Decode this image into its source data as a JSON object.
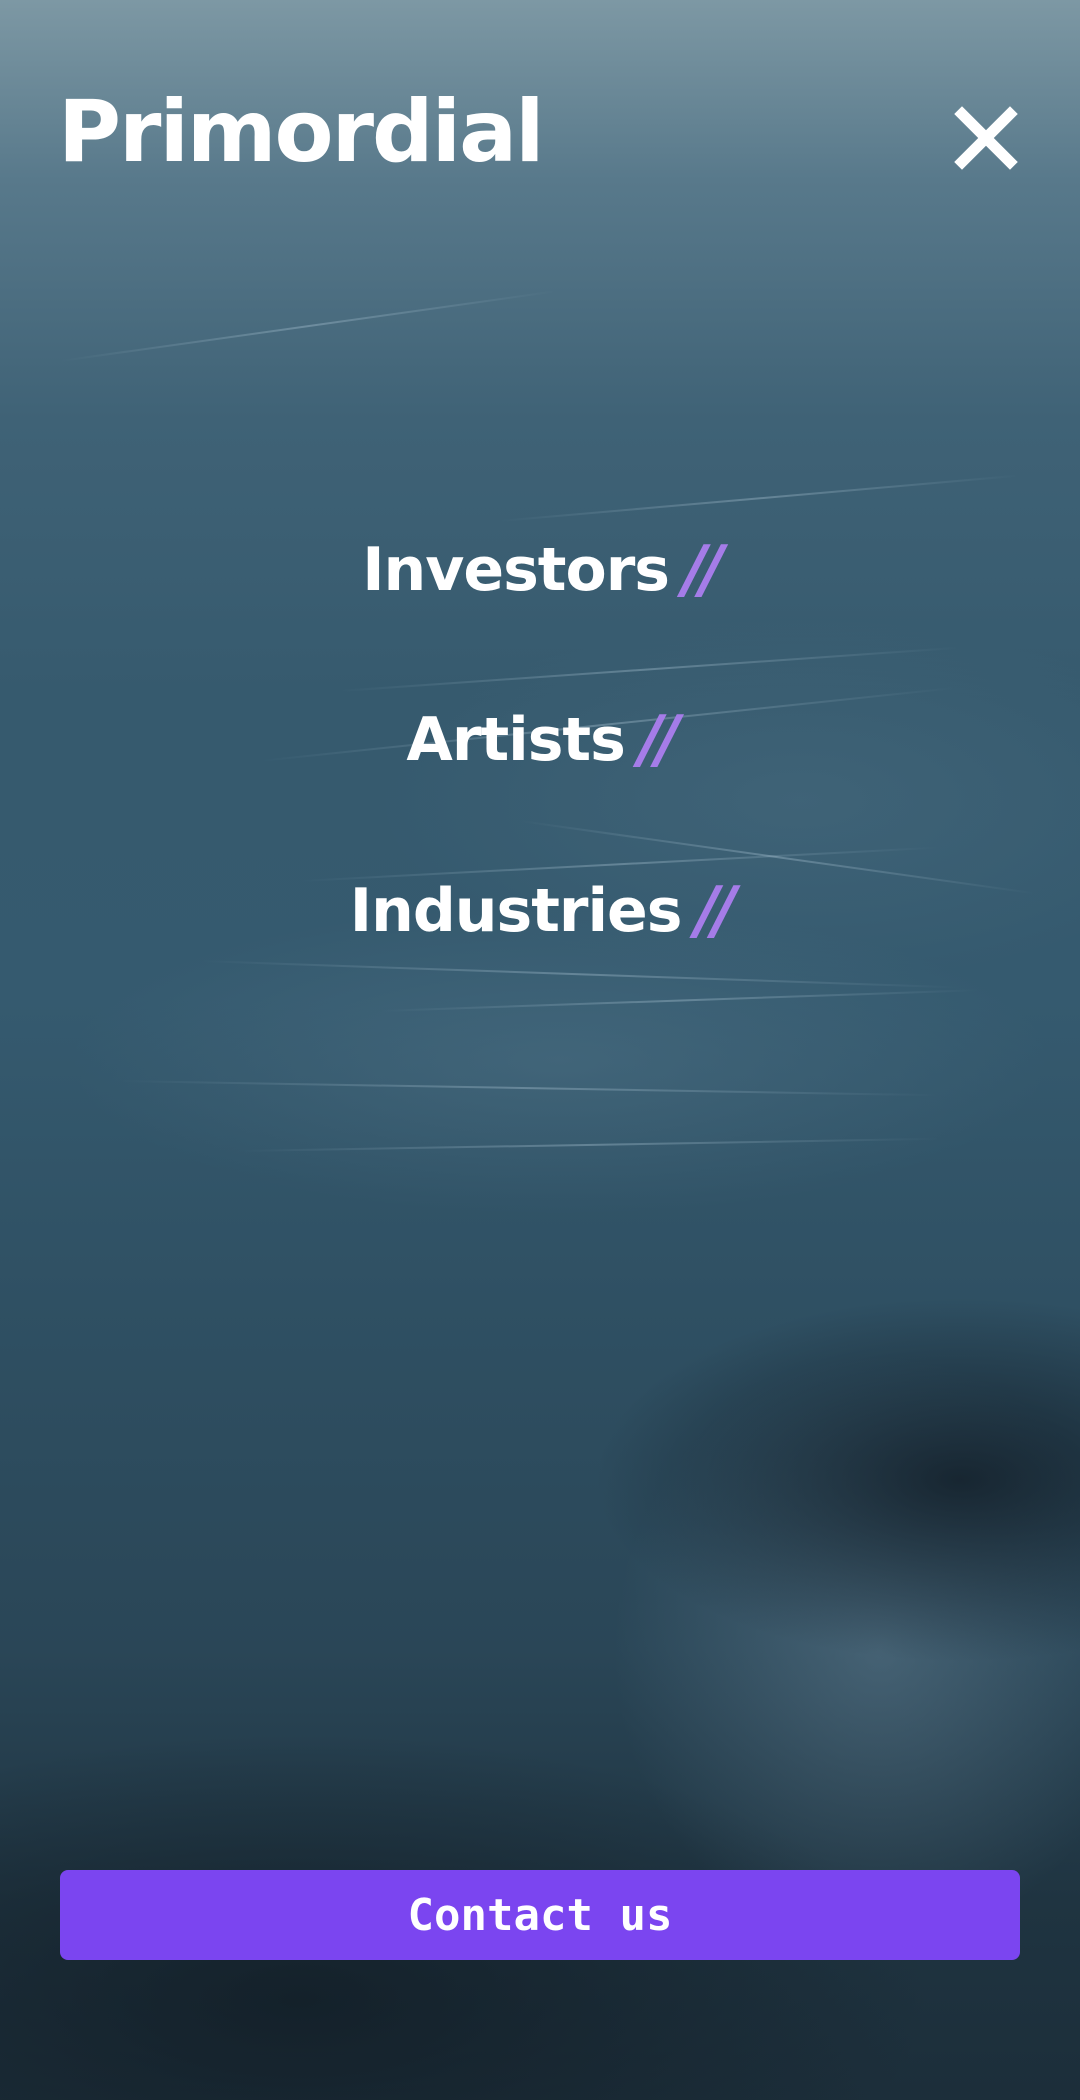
{
  "header": {
    "logo_text": "Primordial",
    "close_icon": "close-icon"
  },
  "nav": {
    "items": [
      {
        "label": "Investors",
        "mark": "//"
      },
      {
        "label": "Artists",
        "mark": "//"
      },
      {
        "label": "Industries",
        "mark": "//"
      }
    ]
  },
  "footer": {
    "contact_label": "Contact us"
  },
  "colors": {
    "accent": "#7b45f0",
    "nav_mark": "#a57ce8",
    "text": "#ffffff",
    "background": "#355a6f"
  }
}
